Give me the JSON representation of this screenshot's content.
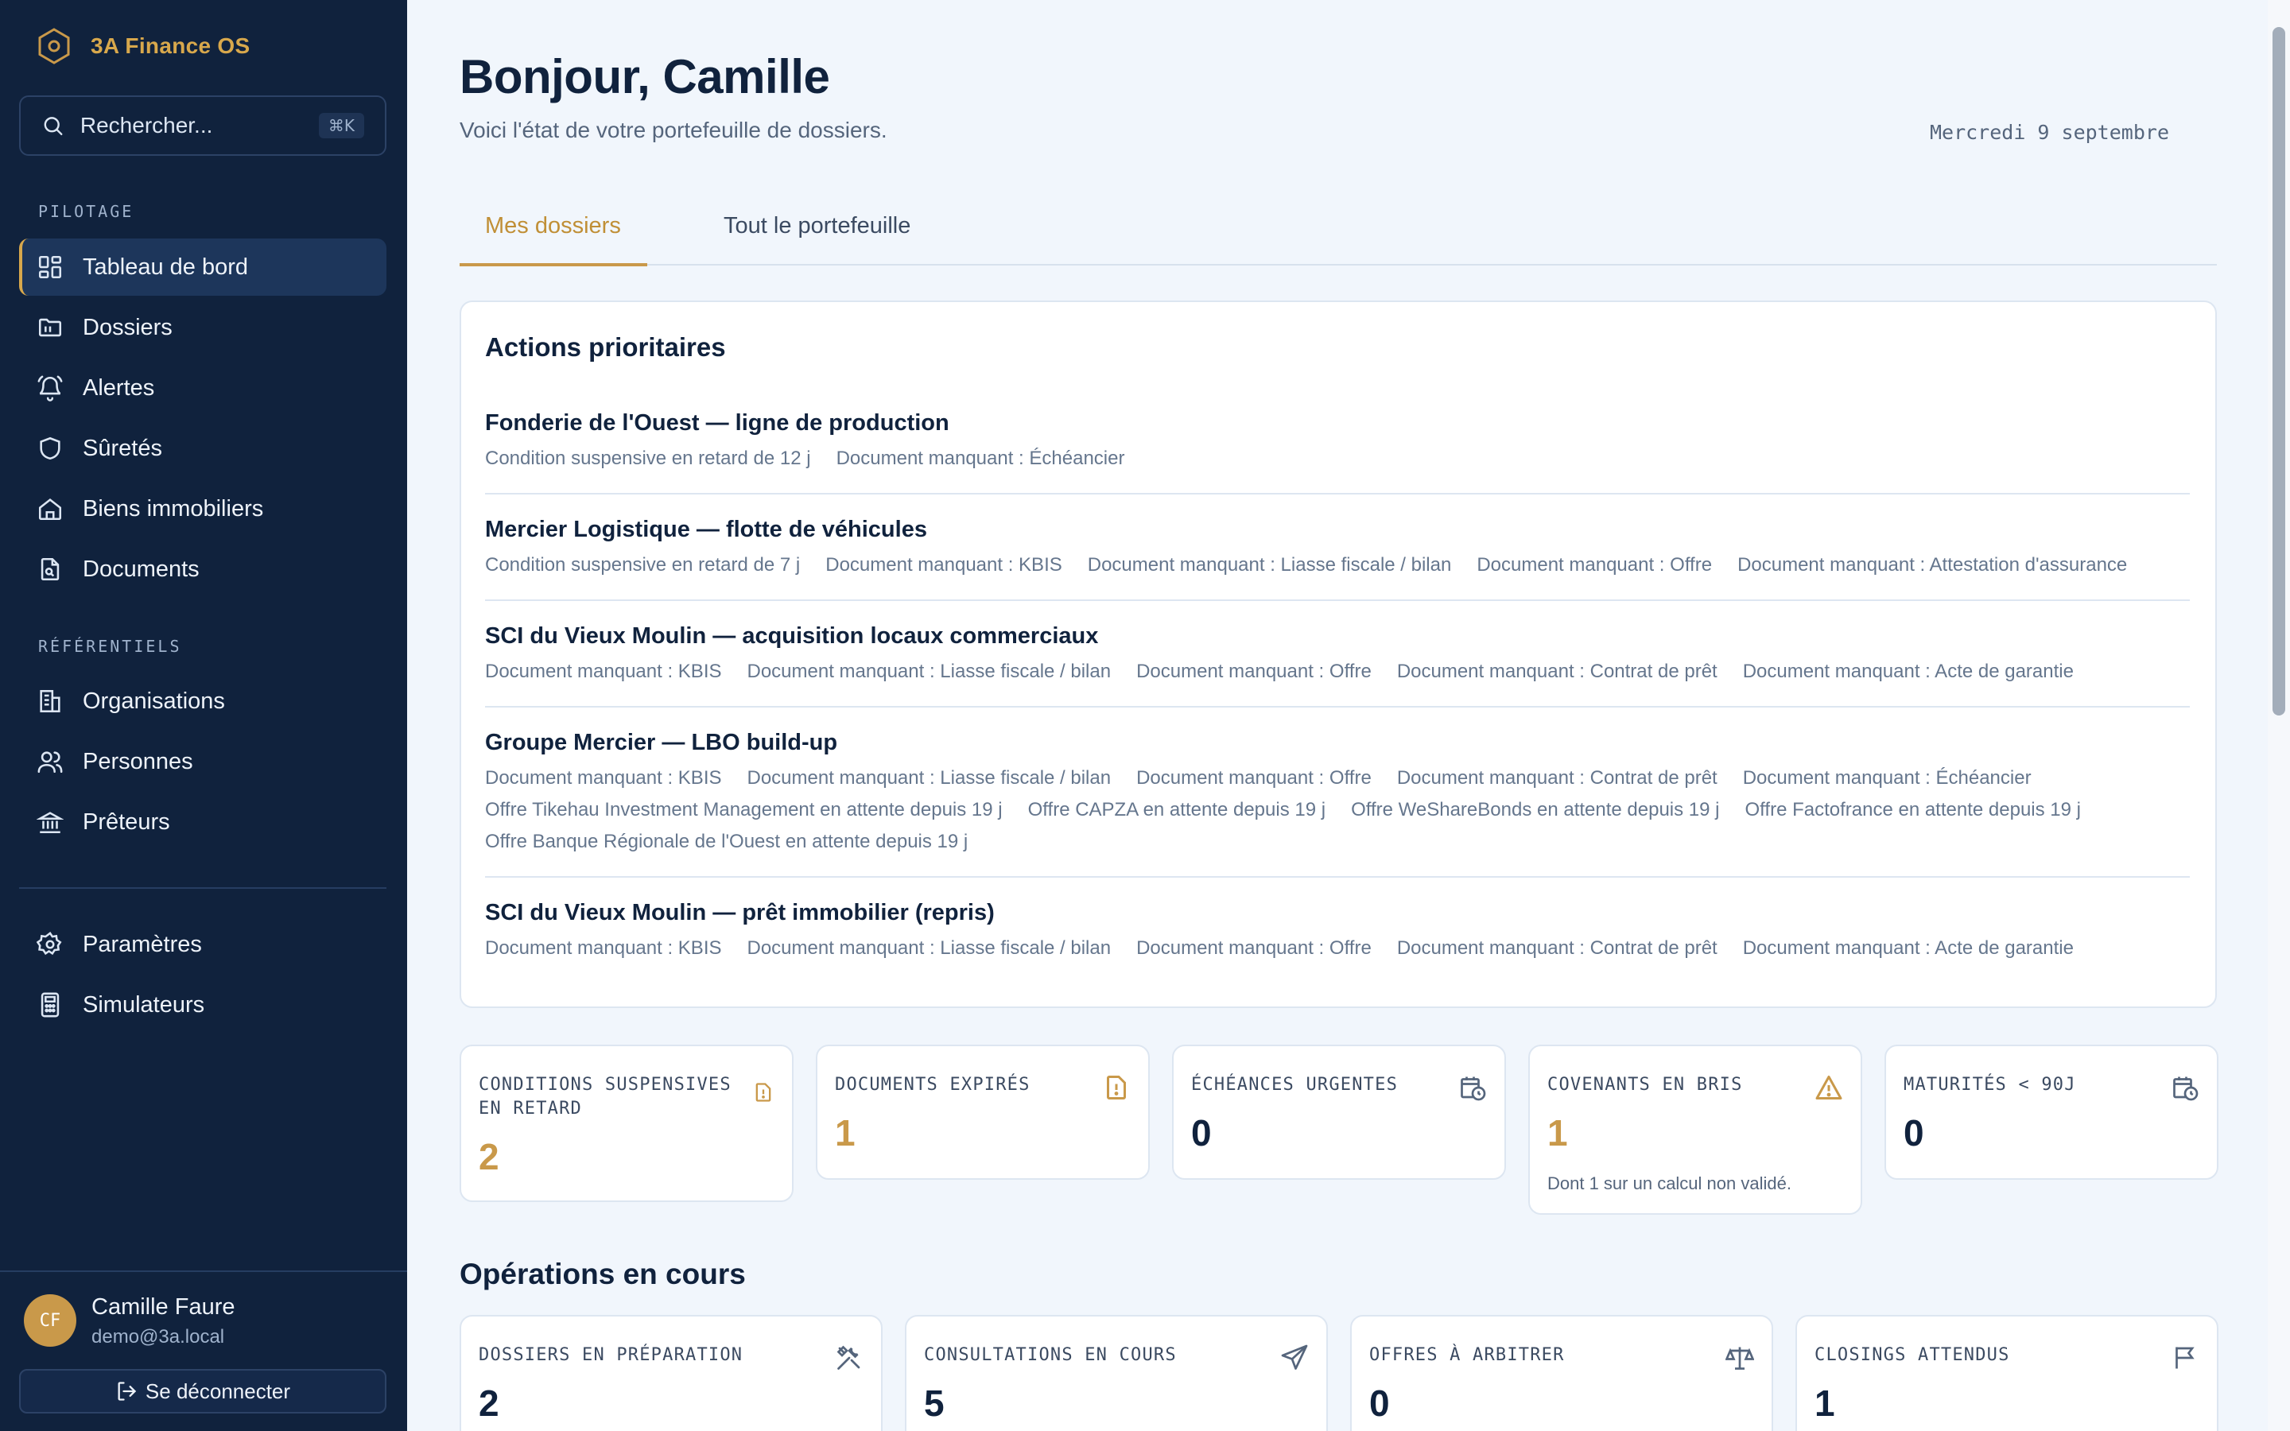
{
  "app": {
    "name": "3A Finance OS"
  },
  "search": {
    "placeholder": "Rechercher...",
    "shortcut": "⌘K"
  },
  "sidebar": {
    "section_pilotage": "PILOTAGE",
    "section_referentiels": "RÉFÉRENTIELS",
    "items": [
      {
        "label": "Tableau de bord",
        "icon": "dashboard-icon",
        "active": true
      },
      {
        "label": "Dossiers",
        "icon": "folder-icon"
      },
      {
        "label": "Alertes",
        "icon": "bell-icon"
      },
      {
        "label": "Sûretés",
        "icon": "shield-icon"
      },
      {
        "label": "Biens immobiliers",
        "icon": "home-icon"
      },
      {
        "label": "Documents",
        "icon": "document-icon"
      },
      {
        "label": "Organisations",
        "icon": "building-icon"
      },
      {
        "label": "Personnes",
        "icon": "users-icon"
      },
      {
        "label": "Prêteurs",
        "icon": "bank-icon"
      },
      {
        "label": "Paramètres",
        "icon": "gear-icon"
      },
      {
        "label": "Simulateurs",
        "icon": "calculator-icon"
      }
    ]
  },
  "user": {
    "initials": "CF",
    "name": "Camille Faure",
    "email": "demo@3a.local",
    "logout_label": "Se déconnecter"
  },
  "header": {
    "greeting": "Bonjour, Camille",
    "subtitle": "Voici l'état de votre portefeuille de dossiers.",
    "date": "Mercredi 9 septembre"
  },
  "tabs": [
    {
      "label": "Mes dossiers",
      "active": true
    },
    {
      "label": "Tout le portefeuille",
      "active": false
    }
  ],
  "priority_actions": {
    "title": "Actions prioritaires",
    "deals": [
      {
        "title": "Fonderie de l'Ouest — ligne de production",
        "tags": [
          "Condition suspensive en retard de 12 j",
          "Document manquant : Échéancier"
        ]
      },
      {
        "title": "Mercier Logistique — flotte de véhicules",
        "tags": [
          "Condition suspensive en retard de 7 j",
          "Document manquant : KBIS",
          "Document manquant : Liasse fiscale / bilan",
          "Document manquant : Offre",
          "Document manquant : Attestation d'assurance"
        ]
      },
      {
        "title": "SCI du Vieux Moulin — acquisition locaux commerciaux",
        "tags": [
          "Document manquant : KBIS",
          "Document manquant : Liasse fiscale / bilan",
          "Document manquant : Offre",
          "Document manquant : Contrat de prêt",
          "Document manquant : Acte de garantie"
        ]
      },
      {
        "title": "Groupe Mercier — LBO build-up",
        "tags": [
          "Document manquant : KBIS",
          "Document manquant : Liasse fiscale / bilan",
          "Document manquant : Offre",
          "Document manquant : Contrat de prêt",
          "Document manquant : Échéancier",
          "Offre Tikehau Investment Management en attente depuis 19 j",
          "Offre CAPZA en attente depuis 19 j",
          "Offre WeShareBonds en attente depuis 19 j",
          "Offre Factofrance en attente depuis 19 j",
          "Offre Banque Régionale de l'Ouest en attente depuis 19 j"
        ]
      },
      {
        "title": "SCI du Vieux Moulin — prêt immobilier (repris)",
        "tags": [
          "Document manquant : KBIS",
          "Document manquant : Liasse fiscale / bilan",
          "Document manquant : Offre",
          "Document manquant : Contrat de prêt",
          "Document manquant : Acte de garantie"
        ]
      }
    ]
  },
  "kpis": [
    {
      "label": "CONDITIONS SUSPENSIVES EN RETARD",
      "value": "2",
      "icon": "file-alert-icon",
      "accent": "#c9994a"
    },
    {
      "label": "DOCUMENTS EXPIRÉS",
      "value": "1",
      "icon": "file-alert-icon",
      "accent": "#c9994a"
    },
    {
      "label": "ÉCHÉANCES URGENTES",
      "value": "0",
      "icon": "calendar-clock-icon",
      "accent": "#10223d"
    },
    {
      "label": "COVENANTS EN BRIS",
      "value": "1",
      "icon": "warning-icon",
      "accent": "#c9994a",
      "note": "Dont 1 sur un calcul non validé."
    },
    {
      "label": "MATURITÉS < 90J",
      "value": "0",
      "icon": "calendar-clock-icon",
      "accent": "#10223d"
    }
  ],
  "operations": {
    "title": "Opérations en cours",
    "cards": [
      {
        "label": "DOSSIERS EN PRÉPARATION",
        "value": "2",
        "icon": "tools-icon"
      },
      {
        "label": "CONSULTATIONS EN COURS",
        "value": "5",
        "icon": "send-icon"
      },
      {
        "label": "OFFRES À ARBITRER",
        "value": "0",
        "icon": "scale-icon"
      },
      {
        "label": "CLOSINGS ATTENDUS",
        "value": "1",
        "icon": "flag-icon"
      }
    ]
  },
  "colors": {
    "sidebar_bg": "#10223d",
    "accent": "#c9994a",
    "main_bg": "#f1f6fc"
  }
}
